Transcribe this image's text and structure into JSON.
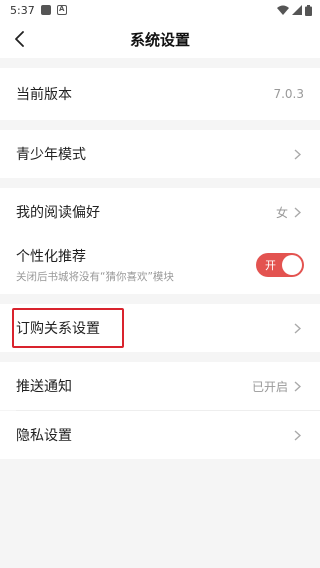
{
  "status_bar": {
    "time": "5:37"
  },
  "nav": {
    "title": "系统设置"
  },
  "settings": {
    "version": {
      "label": "当前版本",
      "value": "7.0.3"
    },
    "youth_mode": {
      "label": "青少年模式"
    },
    "reading_pref": {
      "label": "我的阅读偏好",
      "value": "女"
    },
    "personalized": {
      "label": "个性化推荐",
      "subtitle": "关闭后书城将没有“猜你喜欢”模块",
      "toggle_label": "开",
      "toggle_on": true
    },
    "subscription": {
      "label": "订购关系设置"
    },
    "push": {
      "label": "推送通知",
      "value": "已开启"
    },
    "privacy": {
      "label": "隐私设置"
    }
  },
  "colors": {
    "toggle_on": "#e35350",
    "highlight_border": "#d9232d",
    "background": "#f5f5f5"
  }
}
